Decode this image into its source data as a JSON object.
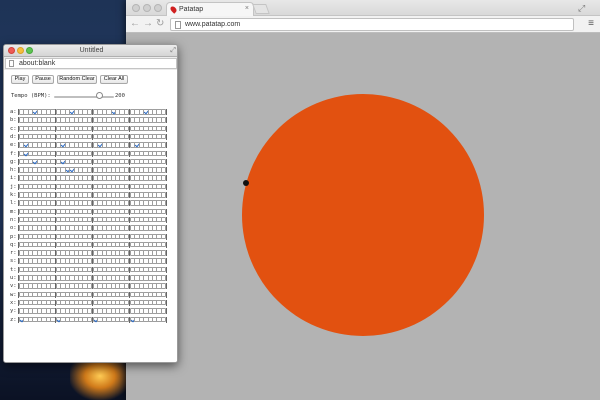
{
  "desktop": {},
  "browser": {
    "tab_title": "Patatap",
    "tab_close": "×",
    "url": "www.patatap.com",
    "back_icon": "arrow-left",
    "forward_icon": "arrow-right",
    "reload_icon": "reload",
    "menu_icon": "hamburger-menu",
    "circle_color": "#e25110",
    "page_background": "#b3b3b3"
  },
  "popup": {
    "title": "Untitled",
    "address": "about:blank",
    "buttons": [
      "Play",
      "Pause",
      "Random Clear",
      "Clear All"
    ],
    "tempo_label": "Tempo (BPM):",
    "tempo_value": "200",
    "tempo_fraction": 0.75,
    "rows": [
      {
        "label": "a:",
        "checked": [
          3,
          11,
          20,
          27
        ]
      },
      {
        "label": "b:",
        "checked": []
      },
      {
        "label": "c:",
        "checked": []
      },
      {
        "label": "d:",
        "checked": []
      },
      {
        "label": "e:",
        "checked": [
          1,
          9,
          17,
          25
        ]
      },
      {
        "label": "f:",
        "checked": [
          1
        ]
      },
      {
        "label": "g:",
        "checked": [
          3,
          9
        ]
      },
      {
        "label": "h:",
        "checked": [
          10,
          11
        ]
      },
      {
        "label": "i:",
        "checked": []
      },
      {
        "label": "j:",
        "checked": []
      },
      {
        "label": "k:",
        "checked": []
      },
      {
        "label": "l:",
        "checked": []
      },
      {
        "label": "m:",
        "checked": []
      },
      {
        "label": "n:",
        "checked": []
      },
      {
        "label": "o:",
        "checked": []
      },
      {
        "label": "p:",
        "checked": []
      },
      {
        "label": "q:",
        "checked": []
      },
      {
        "label": "r:",
        "checked": []
      },
      {
        "label": "s:",
        "checked": []
      },
      {
        "label": "t:",
        "checked": []
      },
      {
        "label": "u:",
        "checked": []
      },
      {
        "label": "v:",
        "checked": []
      },
      {
        "label": "w:",
        "checked": []
      },
      {
        "label": "x:",
        "checked": []
      },
      {
        "label": "y:",
        "checked": []
      },
      {
        "label": "z:",
        "checked": [
          0,
          8,
          16,
          24
        ]
      }
    ],
    "steps": 32
  }
}
